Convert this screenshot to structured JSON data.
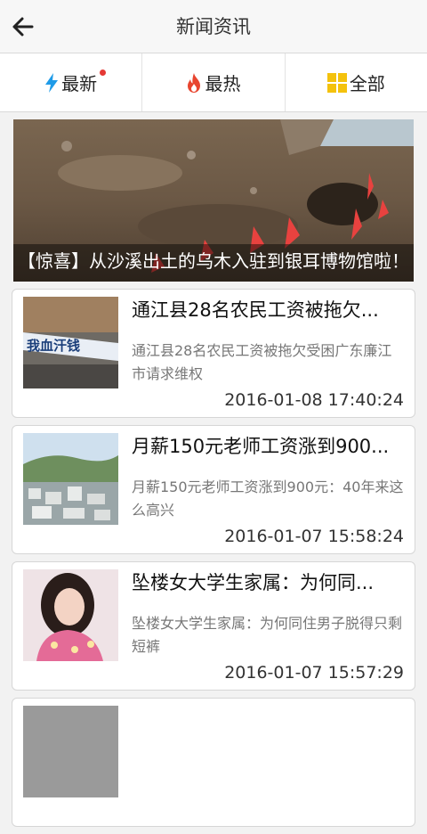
{
  "header": {
    "title": "新闻资讯",
    "back_icon": "back-arrow-icon"
  },
  "tabs": [
    {
      "label": "最新",
      "icon": "lightning-icon",
      "badge": true
    },
    {
      "label": "最热",
      "icon": "flame-icon"
    },
    {
      "label": "全部",
      "icon": "grid-icon"
    }
  ],
  "banner": {
    "caption": "【惊喜】从沙溪出土的乌木入驻到银耳博物馆啦！"
  },
  "news": [
    {
      "title": "通江县28名农民工资被拖欠...",
      "summary": "通江县28名农民工资被拖欠受困广东廉江市请求维权",
      "time": "2016-01-08 17:40:24"
    },
    {
      "title": "月薪150元老师工资涨到900...",
      "summary": "月薪150元老师工资涨到900元：40年来这么高兴",
      "time": "2016-01-07 15:58:24"
    },
    {
      "title": "坠楼女大学生家属：为何同...",
      "summary": "坠楼女大学生家属：为何同住男子脱得只剩短裤",
      "time": "2016-01-07 15:57:29"
    },
    {
      "title": "",
      "summary": "",
      "time": ""
    }
  ],
  "colors": {
    "lightning": "#1e9be8",
    "flame": "#e8452f",
    "grid": "#f4c20d",
    "badge": "#e53935"
  }
}
